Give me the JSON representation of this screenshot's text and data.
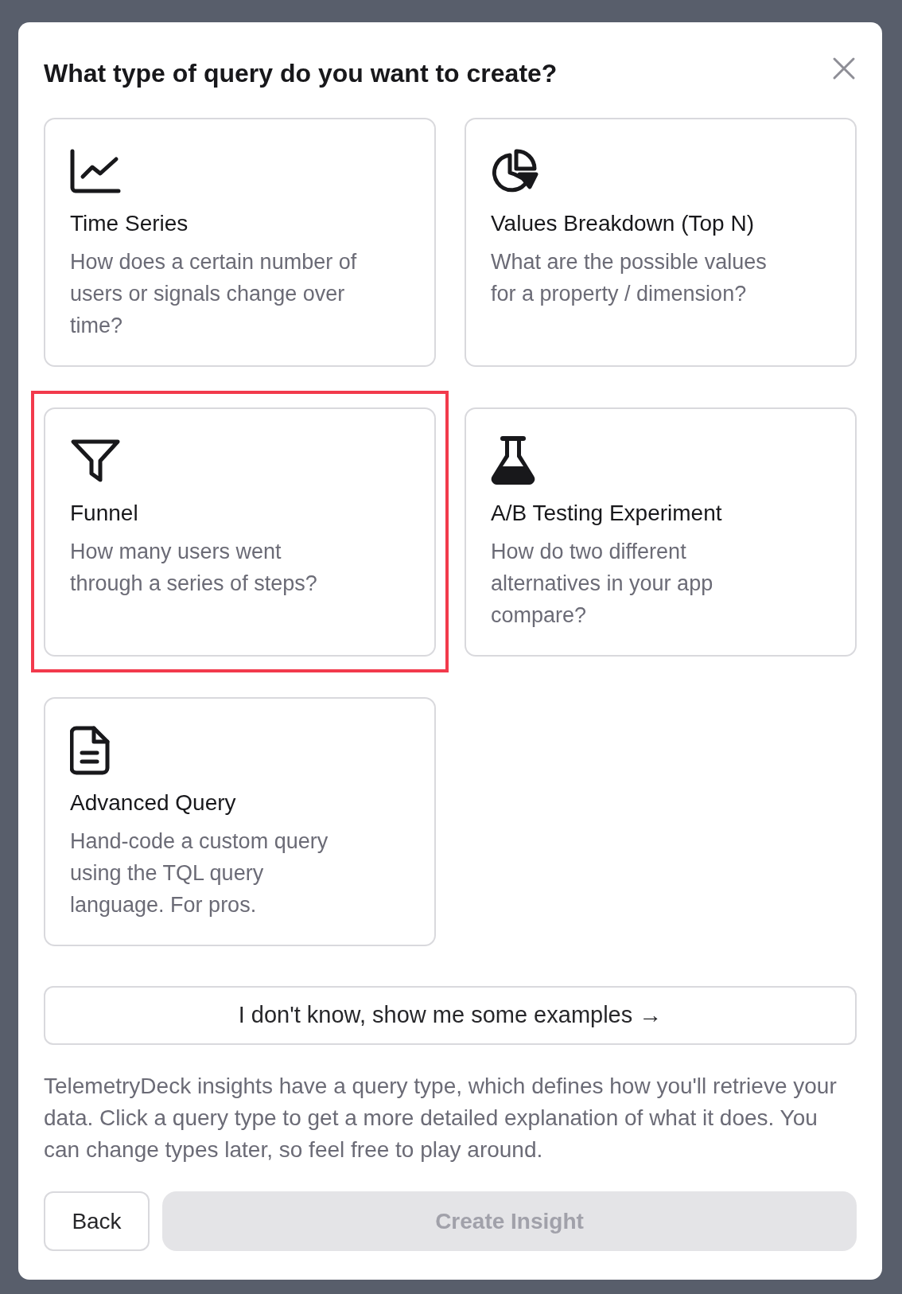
{
  "dialog": {
    "title": "What type of query do you want to create?"
  },
  "query_types": [
    {
      "title": "Time Series",
      "description": "How does a certain number of users or signals change over time?",
      "highlighted": false
    },
    {
      "title": "Values Breakdown (Top N)",
      "description": "What are the possible values for a property / dimension?",
      "highlighted": false
    },
    {
      "title": "Funnel",
      "description": "How many users went through a series of steps?",
      "highlighted": true
    },
    {
      "title": "A/B Testing Experiment",
      "description": "How do two different alternatives in your app compare?",
      "highlighted": false
    },
    {
      "title": "Advanced Query",
      "description": "Hand-code a custom query using the TQL query language. For pros.",
      "highlighted": false
    }
  ],
  "examples_button": "I don't know, show me some examples →",
  "help_text": "TelemetryDeck insights have a query type, which defines how you'll retrieve your data. Click a query type to get a more detailed explanation of what it does. You can change types later, so feel free to play around.",
  "footer": {
    "back_button": "Back",
    "create_button": {
      "label": "Create Insight",
      "disabled": true
    }
  }
}
